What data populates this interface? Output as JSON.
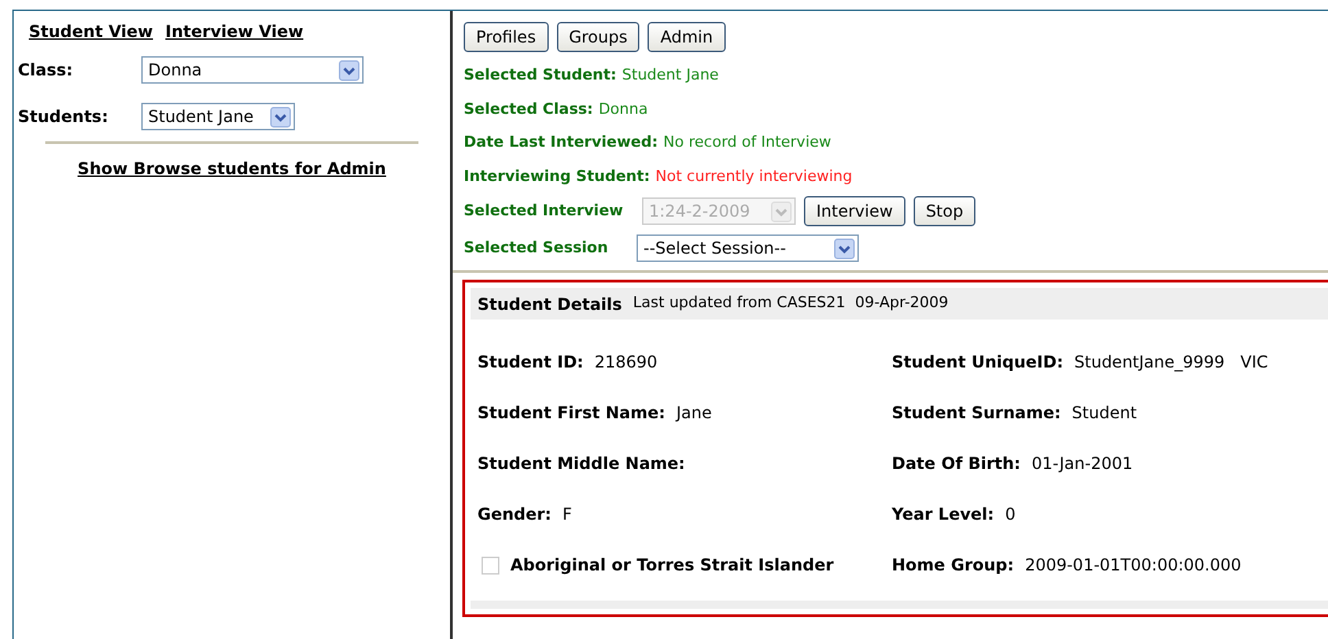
{
  "nav_links": [
    {
      "label": "Student View"
    },
    {
      "label": "Interview View"
    }
  ],
  "class_select": {
    "label": "Class:",
    "value": "Donna"
  },
  "students_select": {
    "label": "Students:",
    "value": "Student Jane"
  },
  "admin_link": "Show Browse students for Admin",
  "buttons": [
    "Profiles",
    "Groups",
    "Admin"
  ],
  "status": [
    {
      "label": "Selected Student:",
      "value": "Student Jane",
      "kind": "ok"
    },
    {
      "label": "Selected Class:",
      "value": "Donna",
      "kind": "ok"
    },
    {
      "label": "Date Last Interviewed:",
      "value": "No record of Interview",
      "kind": "ok"
    },
    {
      "label": "Interviewing Student:",
      "value": "Not currently interviewing",
      "kind": "alert"
    }
  ],
  "interview": {
    "label": "Selected Interview",
    "value": "1:24-2-2009",
    "disabled": true,
    "buttons": [
      "Interview",
      "Stop"
    ]
  },
  "session": {
    "label": "Selected Session",
    "value": "--Select Session--"
  },
  "details": {
    "title": "Student Details",
    "subtitle": "Last updated from CASES21  09-Apr-2009",
    "fields": [
      {
        "kind": "field",
        "label": "Student ID:",
        "value": "218690"
      },
      {
        "kind": "field",
        "label": "Student UniqueID:",
        "value": "StudentJane_9999   VIC"
      },
      {
        "kind": "field",
        "label": "Student First Name:",
        "value": "Jane"
      },
      {
        "kind": "field",
        "label": "Student Surname:",
        "value": "Student"
      },
      {
        "kind": "field",
        "label": "Student Middle Name:"
      },
      {
        "kind": "field",
        "label": "Date Of Birth:",
        "value": "01-Jan-2001"
      },
      {
        "kind": "field",
        "label": "Gender:",
        "value": "F"
      },
      {
        "kind": "field",
        "label": "Year Level:",
        "value": "0"
      },
      {
        "kind": "checkbox",
        "label": "Aboriginal or Torres Strait Islander",
        "checked": false
      },
      {
        "kind": "field",
        "label": "Home Group:",
        "value": "2009-01-01T00:00:00.000"
      }
    ]
  }
}
